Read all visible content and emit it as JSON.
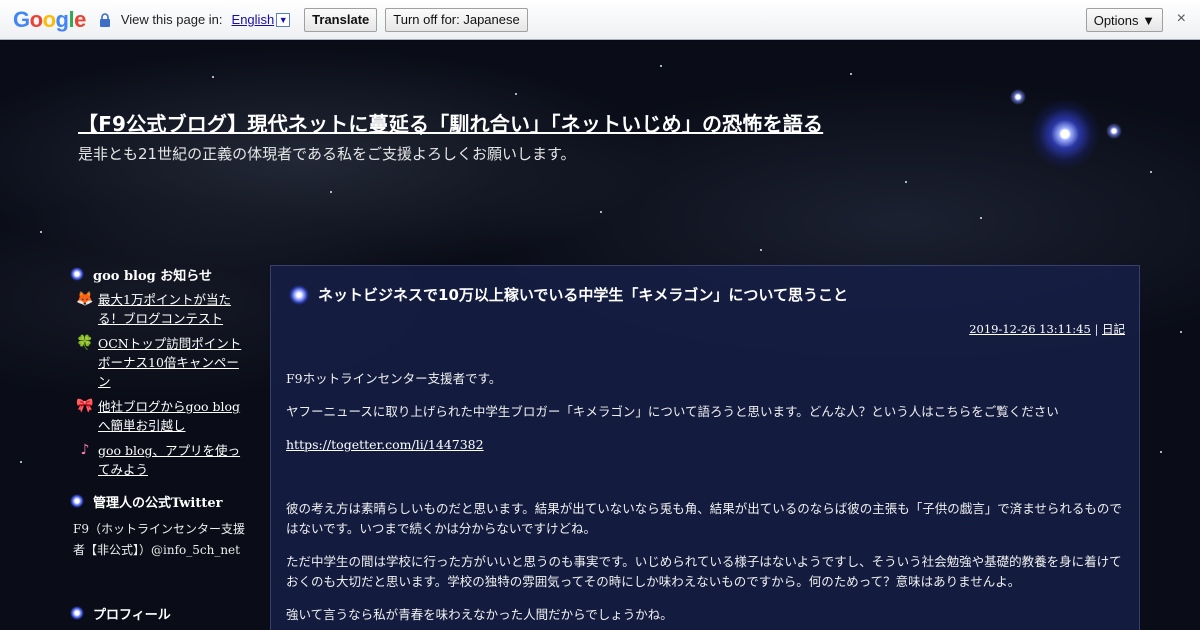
{
  "translate_bar": {
    "logo_letters": [
      "G",
      "o",
      "o",
      "g",
      "l",
      "e"
    ],
    "view_label": "View this page in:",
    "language": "English",
    "translate_button": "Translate",
    "turn_off_button": "Turn off for: Japanese",
    "options_button": "Options ▼",
    "close_glyph": "×"
  },
  "header": {
    "title": "【F9公式ブログ】現代ネットに蔓延る「馴れ合い」「ネットいじめ」の恐怖を語る",
    "description": "是非とも21世紀の正義の体現者である私をご支援よろしくお願いします。"
  },
  "sidebar": {
    "notice_heading": "goo blog お知らせ",
    "notices": [
      {
        "icon": "🦊",
        "text": "最大1万ポイントが当たる！ブログコンテスト"
      },
      {
        "icon": "🍀",
        "text": "OCNトップ訪問ポイントボーナス10倍キャンペーン"
      },
      {
        "icon": "🎀",
        "text": "他社ブログからgoo blogへ簡単お引越し"
      },
      {
        "icon": "♪",
        "text": "goo blog、アプリを使ってみよう"
      }
    ],
    "twitter_heading": "管理人の公式Twitter",
    "twitter_text": "F9（ホットラインセンター支援者【非公式】）@info_5ch_net",
    "profile_heading": "プロフィール"
  },
  "entry": {
    "title": "ネットビジネスで10万以上稼いでいる中学生「キメラゴン」について思うこと",
    "date": "2019-12-26 13:11:45",
    "separator": "|",
    "category": "日記",
    "paragraphs": [
      "F9ホットラインセンター支援者です。",
      "ヤフーニュースに取り上げられた中学生ブロガー「キメラゴン」について語ろうと思います。どんな人？という人はこちらをご覧ください",
      "https://togetter.com/li/1447382",
      "彼の考え方は素晴らしいものだと思います。結果が出ていないなら兎も角、結果が出ているのならば彼の主張も「子供の戯言」で済ませられるものではないです。いつまで続くかは分からないですけどね。",
      "ただ中学生の間は学校に行った方がいいと思うのも事実です。いじめられている様子はないようですし、そういう社会勉強や基礎的教養を身に着けておくのも大切だと思います。学校の独特の雰囲気ってその時にしか味わえないものですから。何のためって？意味はありませんよ。",
      "強いて言うなら私が青春を味わえなかった人間だからでしょうかね。"
    ]
  },
  "colors": {
    "main_panel": "#16204a",
    "sky": "#0a0d18",
    "link": "#ffffff"
  }
}
